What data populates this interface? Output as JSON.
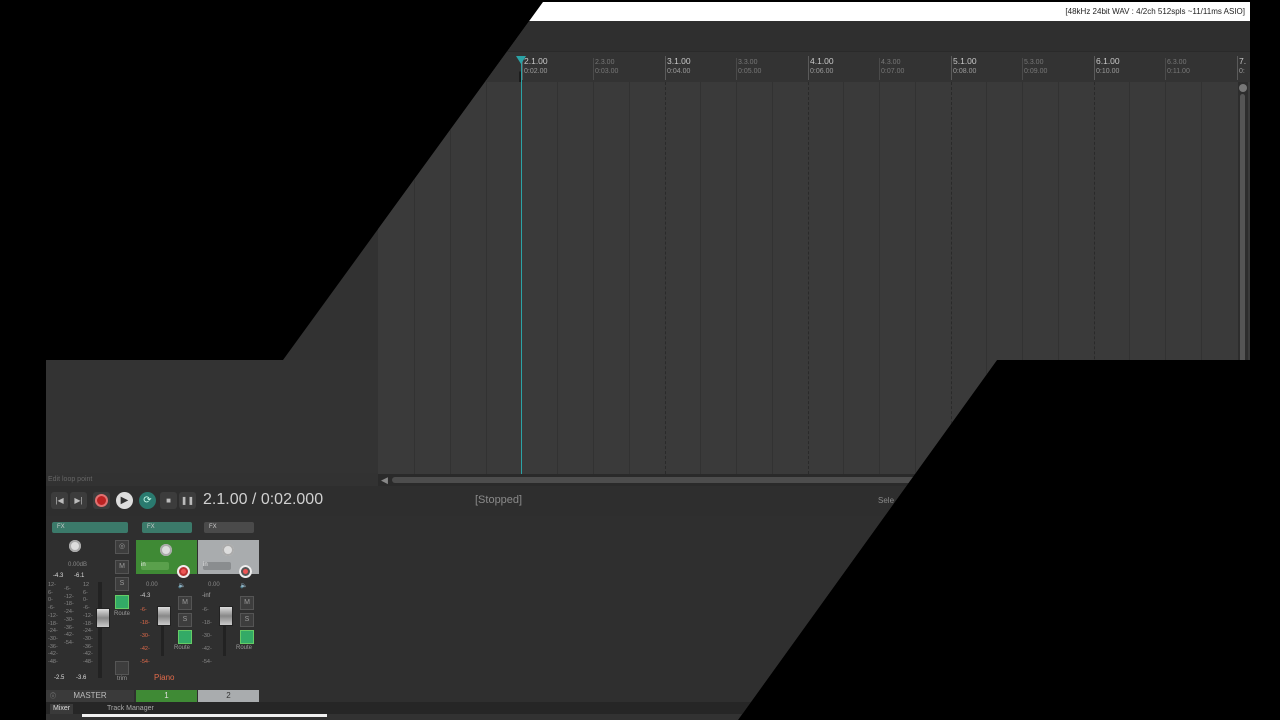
{
  "window": {
    "status": "[48kHz 24bit WAV : 4/2ch 512spls ~11/11ms ASIO]"
  },
  "ruler": {
    "bars": [
      {
        "label": "2.1.00",
        "time": "0:02.00"
      },
      {
        "label": "3.1.00",
        "time": "0:04.00"
      },
      {
        "label": "4.1.00",
        "time": "0:06.00"
      },
      {
        "label": "5.1.00",
        "time": "0:08.00"
      },
      {
        "label": "6.1.00",
        "time": "0:10.00"
      },
      {
        "label": "7.",
        "time": "0:"
      }
    ],
    "beats": [
      {
        "label": "2.3.00",
        "time": "0:03.00"
      },
      {
        "label": "3.3.00",
        "time": "0:05.00"
      },
      {
        "label": "4.3.00",
        "time": "0:07.00"
      },
      {
        "label": "5.3.00",
        "time": "0:09.00"
      },
      {
        "label": "6.3.00",
        "time": "0:11.00"
      }
    ]
  },
  "transport": {
    "tooltip": "Edit loop point",
    "position": "2.1.00 / 0:02.000",
    "state": "[Stopped]",
    "selection_label": "Sele",
    "buttons": {
      "prev": "|◀",
      "next": "▶|",
      "stop": "■",
      "pause": "❚❚"
    }
  },
  "mixer": {
    "master": {
      "fx": "FX",
      "vol_db": "0.00dB",
      "peak_l": "-4.3",
      "peak_r": "-6.1",
      "scale_left": "12-\n6-\n0-\n-6-\n-12-\n-18-\n-24-\n-30-\n-36-\n-42-\n-48-",
      "scale_mid": "-6-\n-12-\n-18-\n-24-\n-30-\n-36-\n-42-\n-54-",
      "scale_right": "12\n6-\n0-\n-6-\n-12-\n-18-\n-24-\n-30-\n-36-\n-42-\n-48-",
      "bottom_l": "-2.5",
      "bottom_r": "-3.6",
      "mute": "M",
      "solo": "S",
      "route": "Route",
      "trim": "trim",
      "name": "MASTER"
    },
    "tracks": [
      {
        "fx": "FX",
        "input": "in",
        "vol": "0.00",
        "peak": "-4.3",
        "scale": "-6-\n-18-\n-30-\n-42-\n-54-",
        "mute": "M",
        "solo": "S",
        "route": "Route",
        "name": "Piano",
        "num": "1"
      },
      {
        "fx": "FX",
        "input": "in",
        "vol": "0.00",
        "peak": "-inf",
        "scale": "-6-\n-18-\n-30-\n-42-\n-54-",
        "mute": "M",
        "solo": "S",
        "route": "Route",
        "name": "",
        "num": "2"
      }
    ]
  },
  "dock": {
    "tabs": [
      "Mixer",
      "Track Manager"
    ]
  }
}
